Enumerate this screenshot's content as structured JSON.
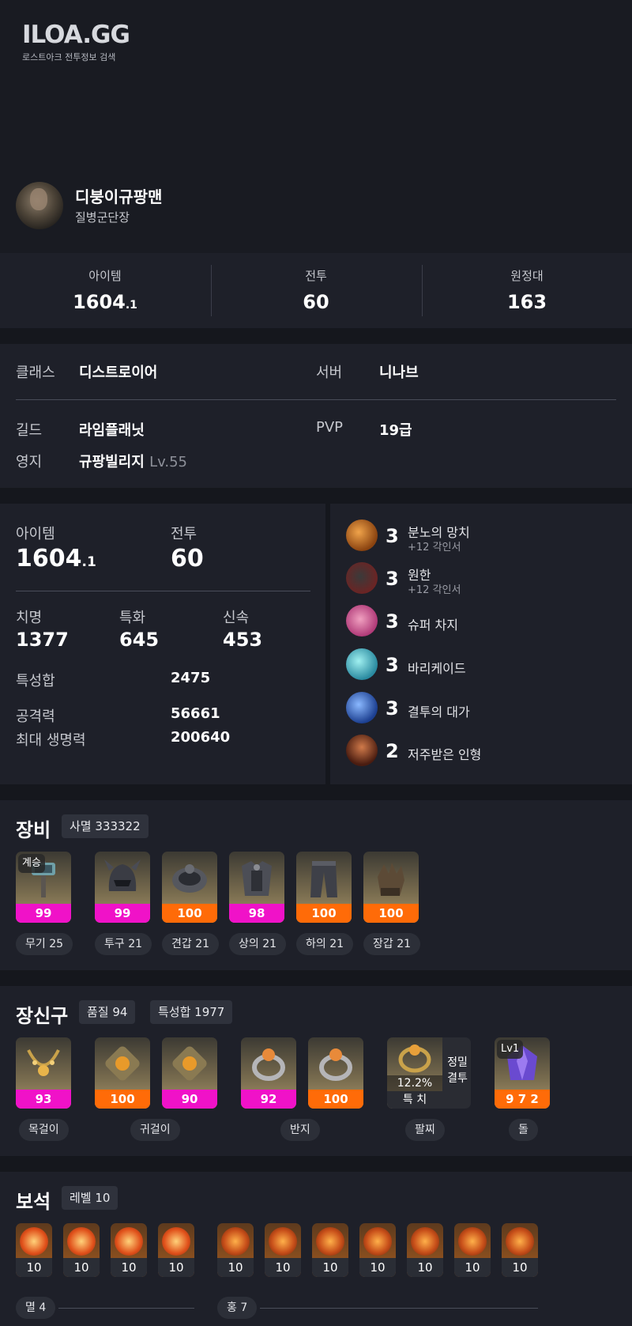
{
  "site": {
    "logo": "ILOA.GG",
    "subtitle": "로스트아크 전투정보 검색"
  },
  "character": {
    "name": "디붕이규팡맨",
    "title": "질병군단장"
  },
  "summary": [
    {
      "label": "아이템",
      "value": "1604",
      "decimal": ".1"
    },
    {
      "label": "전투",
      "value": "60"
    },
    {
      "label": "원정대",
      "value": "163"
    }
  ],
  "info": {
    "class_label": "클래스",
    "class_value": "디스트로이어",
    "server_label": "서버",
    "server_value": "니나브",
    "guild_label": "길드",
    "guild_value": "라임플래닛",
    "pvp_label": "PVP",
    "pvp_value": "19급",
    "estate_label": "영지",
    "estate_value": "규팡빌리지",
    "estate_level": "Lv.55"
  },
  "stats": {
    "item_label": "아이템",
    "item_value": "1604",
    "item_decimal": ".1",
    "combat_label": "전투",
    "combat_value": "60",
    "crit_label": "치명",
    "crit_value": "1377",
    "spec_label": "특화",
    "spec_value": "645",
    "swift_label": "신속",
    "swift_value": "453",
    "total_label": "특성합",
    "total_value": "2475",
    "atk_label": "공격력",
    "atk_value": "56661",
    "hp_label": "최대 생명력",
    "hp_value": "200640"
  },
  "engravings": [
    {
      "level": "3",
      "name": "분노의 망치",
      "sub": "+12 각인서",
      "icon": "hammer-engraving-icon",
      "color": "#c46d16"
    },
    {
      "level": "3",
      "name": "원한",
      "sub": "+12 각인서",
      "icon": "grudge-engraving-icon",
      "color": "#5a2a2a"
    },
    {
      "level": "3",
      "name": "슈퍼 차지",
      "sub": "",
      "icon": "super-charge-engraving-icon",
      "color": "#c04a88"
    },
    {
      "level": "3",
      "name": "바리케이드",
      "sub": "",
      "icon": "barricade-engraving-icon",
      "color": "#3aa0b5"
    },
    {
      "level": "3",
      "name": "결투의 대가",
      "sub": "",
      "icon": "duel-master-engraving-icon",
      "color": "#2d5aa8"
    },
    {
      "level": "2",
      "name": "저주받은 인형",
      "sub": "",
      "icon": "cursed-doll-engraving-icon",
      "color": "#8a3a1e"
    }
  ],
  "equipment": {
    "title": "장비",
    "set_label": "사멸 333322",
    "badge": "계승",
    "items": [
      {
        "quality": "99",
        "tier": "pink",
        "label": "무기 25",
        "icon": "weapon-hammer-icon"
      },
      {
        "quality": "99",
        "tier": "pink",
        "label": "투구 21",
        "icon": "helmet-icon"
      },
      {
        "quality": "100",
        "tier": "orange",
        "label": "견갑 21",
        "icon": "shoulder-icon"
      },
      {
        "quality": "98",
        "tier": "pink",
        "label": "상의 21",
        "icon": "chest-armor-icon"
      },
      {
        "quality": "100",
        "tier": "orange",
        "label": "하의 21",
        "icon": "pants-icon"
      },
      {
        "quality": "100",
        "tier": "orange",
        "label": "장갑 21",
        "icon": "gloves-icon"
      }
    ]
  },
  "accessories": {
    "title": "장신구",
    "quality_label": "품질 94",
    "stat_label": "특성합 1977",
    "items": [
      {
        "quality": "93",
        "tier": "pink",
        "icon": "necklace-icon"
      },
      {
        "quality": "100",
        "tier": "orange",
        "icon": "earring-icon"
      },
      {
        "quality": "90",
        "tier": "pink",
        "icon": "earring-icon"
      },
      {
        "quality": "92",
        "tier": "pink",
        "icon": "ring-icon"
      },
      {
        "quality": "100",
        "tier": "orange",
        "icon": "ring-icon"
      }
    ],
    "bracelet": {
      "percent": "12.2%",
      "stat": "특 치",
      "effect_line1": "정밀",
      "effect_line2": "결투",
      "icon": "bracelet-icon"
    },
    "stone": {
      "badge": "Lv1",
      "value": "9 7 2",
      "icon": "ability-stone-icon"
    },
    "labels": {
      "necklace": "목걸이",
      "earring": "귀걸이",
      "ring": "반지",
      "bracelet": "팔찌",
      "stone": "돌"
    }
  },
  "gems": {
    "title": "보석",
    "level_label": "레벨 10",
    "annihilation": [
      "10",
      "10",
      "10",
      "10"
    ],
    "crimson": [
      "10",
      "10",
      "10",
      "10",
      "10",
      "10",
      "10"
    ],
    "annihilation_label": "멸 4",
    "crimson_label": "홍 7"
  }
}
